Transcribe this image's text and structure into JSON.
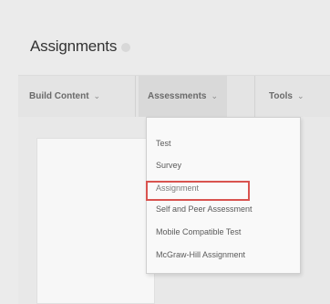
{
  "page": {
    "title": "Assignments"
  },
  "toolbar": {
    "build_content": "Build Content",
    "assessments": "Assessments",
    "tools": "Tools",
    "chevron": "⌄"
  },
  "menu": {
    "items": [
      "Test",
      "Survey",
      "Assignment",
      "Self and Peer Assessment",
      "Mobile Compatible Test",
      "McGraw-Hill Assignment"
    ]
  },
  "colors": {
    "highlight_border": "#d9534f",
    "background": "#ebebeb"
  }
}
